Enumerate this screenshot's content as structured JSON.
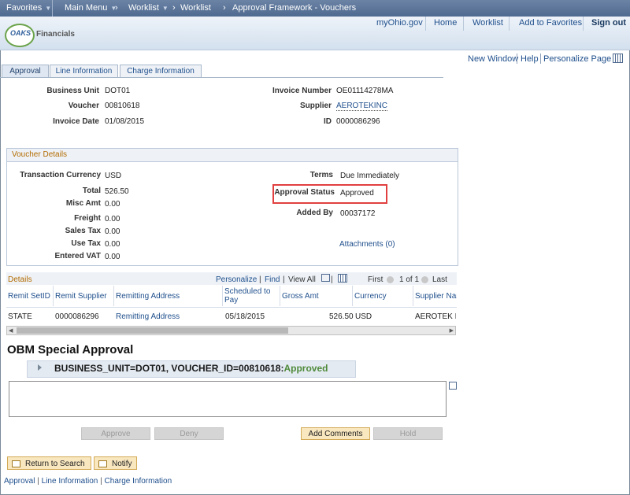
{
  "topnav": {
    "favorites": "Favorites",
    "main_menu": "Main Menu",
    "worklist1": "Worklist",
    "worklist2": "Worklist",
    "crumb": "Approval Framework - Vouchers"
  },
  "header": {
    "logo": "OAKS",
    "brand": "Financials",
    "links": [
      "myOhio.gov",
      "Home",
      "Worklist",
      "Add to Favorites",
      "Sign out"
    ]
  },
  "page_links": [
    "New Window",
    "Help",
    "Personalize Page"
  ],
  "tabs": [
    "Approval",
    "Line Information",
    "Charge Information"
  ],
  "summary": {
    "business_unit_label": "Business Unit",
    "business_unit": "DOT01",
    "voucher_label": "Voucher",
    "voucher": "00810618",
    "invoice_date_label": "Invoice Date",
    "invoice_date": "01/08/2015",
    "invoice_number_label": "Invoice Number",
    "invoice_number": "OE01114278MA",
    "supplier_label": "Supplier",
    "supplier": "AEROTEKINC",
    "id_label": "ID",
    "id": "0000086296"
  },
  "voucher_details": {
    "title": "Voucher Details",
    "transaction_currency_label": "Transaction Currency",
    "transaction_currency": "USD",
    "total_label": "Total",
    "total": "526.50",
    "misc_amt_label": "Misc Amt",
    "misc_amt": "0.00",
    "freight_label": "Freight",
    "freight": "0.00",
    "sales_tax_label": "Sales Tax",
    "sales_tax": "0.00",
    "use_tax_label": "Use Tax",
    "use_tax": "0.00",
    "entered_vat_label": "Entered VAT",
    "entered_vat": "0.00",
    "terms_label": "Terms",
    "terms": "Due Immediately",
    "approval_status_label": "Approval Status",
    "approval_status": "Approved",
    "added_by_label": "Added By",
    "added_by": "00037172",
    "attachments": "Attachments (0)"
  },
  "details": {
    "title": "Details",
    "personalize": "Personalize",
    "find": "Find",
    "view_all": "View All",
    "first": "First",
    "range": "1 of 1",
    "last": "Last",
    "columns": [
      "Remit SetID",
      "Remit Supplier",
      "Remitting Address",
      "Scheduled to Pay",
      "Gross Amt",
      "Currency",
      "Supplier Name"
    ],
    "rows": [
      [
        "STATE",
        "0000086296",
        "Remitting Address",
        "05/18/2015",
        "526.50",
        "USD",
        "AEROTEK INC"
      ]
    ]
  },
  "obm": {
    "title": "OBM Special Approval",
    "bu_text": "BUSINESS_UNIT=DOT01, VOUCHER_ID=00810618:",
    "status": "Approved"
  },
  "buttons": {
    "approve": "Approve",
    "deny": "Deny",
    "add_comments": "Add Comments",
    "hold": "Hold",
    "return_to_search": "Return to Search",
    "notify": "Notify"
  },
  "bottom_links": [
    "Approval",
    "Line Information",
    "Charge Information"
  ]
}
